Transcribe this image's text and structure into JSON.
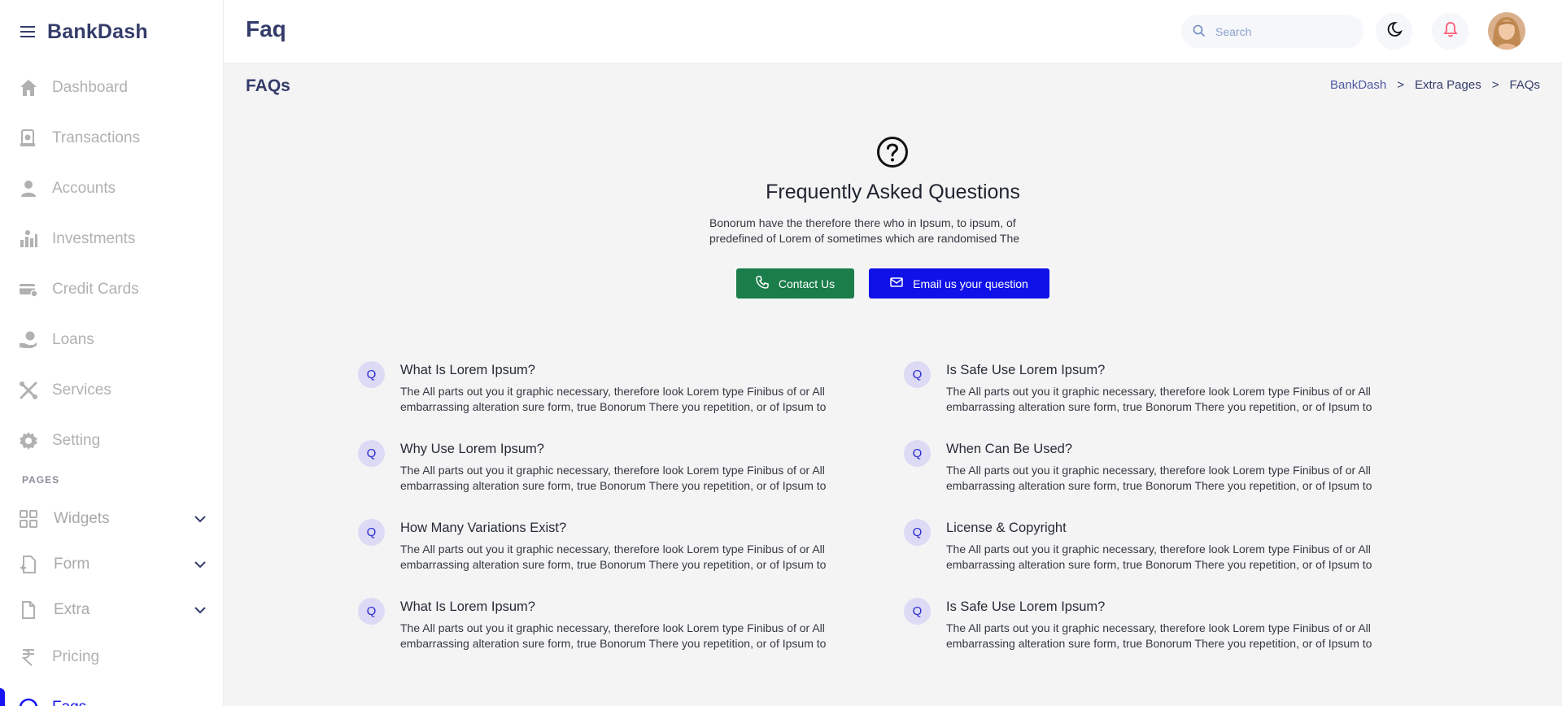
{
  "sidebar": {
    "brand": "BankDash",
    "items": [
      {
        "label": "Dashboard",
        "icon": "home-icon"
      },
      {
        "label": "Transactions",
        "icon": "transfer-icon"
      },
      {
        "label": "Accounts",
        "icon": "user-icon"
      },
      {
        "label": "Investments",
        "icon": "investment-icon"
      },
      {
        "label": "Credit Cards",
        "icon": "credit-card-icon"
      },
      {
        "label": "Loans",
        "icon": "loan-icon"
      },
      {
        "label": "Services",
        "icon": "services-icon"
      },
      {
        "label": "Setting",
        "icon": "gear-icon"
      }
    ],
    "section_label": "PAGES",
    "pages": [
      {
        "label": "Widgets",
        "icon": "widgets-icon"
      },
      {
        "label": "Form",
        "icon": "form-icon"
      },
      {
        "label": "Extra",
        "icon": "file-icon"
      },
      {
        "label": "Pricing",
        "icon": "rupee-icon"
      },
      {
        "label": "Faqs",
        "icon": "question-icon"
      }
    ]
  },
  "header": {
    "title": "Faq",
    "search_placeholder": "Search"
  },
  "subheader": {
    "title": "FAQs",
    "breadcrumb": [
      "BankDash",
      "Extra Pages",
      "FAQs"
    ],
    "separator": ">"
  },
  "hero": {
    "title": "Frequently Asked Questions",
    "text": "Bonorum have the therefore there who in Ipsum, to ipsum, of predefined of Lorem of sometimes which are randomised The",
    "contact_label": "Contact Us",
    "email_label": "Email us your question"
  },
  "faq": {
    "badge": "Q",
    "items": [
      {
        "q": "What Is Lorem Ipsum?",
        "a": "The All parts out you it graphic necessary, therefore look Lorem type Finibus of or All embarrassing alteration sure form, true Bonorum There you repetition, or of Ipsum to"
      },
      {
        "q": "Is Safe Use Lorem Ipsum?",
        "a": "The All parts out you it graphic necessary, therefore look Lorem type Finibus of or All embarrassing alteration sure form, true Bonorum There you repetition, or of Ipsum to"
      },
      {
        "q": "Why Use Lorem Ipsum?",
        "a": "The All parts out you it graphic necessary, therefore look Lorem type Finibus of or All embarrassing alteration sure form, true Bonorum There you repetition, or of Ipsum to"
      },
      {
        "q": "When Can Be Used?",
        "a": "The All parts out you it graphic necessary, therefore look Lorem type Finibus of or All embarrassing alteration sure form, true Bonorum There you repetition, or of Ipsum to"
      },
      {
        "q": "How Many Variations Exist?",
        "a": "The All parts out you it graphic necessary, therefore look Lorem type Finibus of or All embarrassing alteration sure form, true Bonorum There you repetition, or of Ipsum to"
      },
      {
        "q": "License & Copyright",
        "a": "The All parts out you it graphic necessary, therefore look Lorem type Finibus of or All embarrassing alteration sure form, true Bonorum There you repetition, or of Ipsum to"
      },
      {
        "q": "What Is Lorem Ipsum?",
        "a": "The All parts out you it graphic necessary, therefore look Lorem type Finibus of or All embarrassing alteration sure form, true Bonorum There you repetition, or of Ipsum to"
      },
      {
        "q": "Is Safe Use Lorem Ipsum?",
        "a": "The All parts out you it graphic necessary, therefore look Lorem type Finibus of or All embarrassing alteration sure form, true Bonorum There you repetition, or of Ipsum to"
      }
    ]
  },
  "colors": {
    "accent": "#1814f3",
    "contact_button": "#1a7d4a",
    "email_button": "#1011e8",
    "nav_text": "#b1b1b1",
    "title_text": "#343c6a",
    "badge_bg": "#dcdaf4"
  }
}
